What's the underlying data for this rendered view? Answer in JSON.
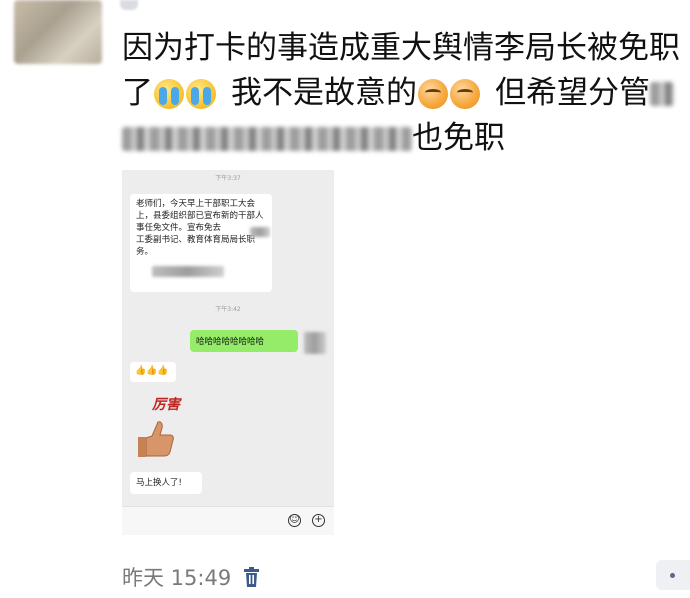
{
  "post": {
    "line1": "因为打卡的事造成重大舆情李局长被免职",
    "line2_a": "了",
    "line2_b": "我不是故意的",
    "line2_c": "但希望分管",
    "line3_end": "也免职"
  },
  "embedded_chat": {
    "time_1": "下午3:37",
    "message_1": "老师们，今天早上干部职工大会上，县委组织部已宣布新的干部人事任免文件。宣布免去",
    "message_1_b": "工委副书记、教育体育局局长职务。",
    "time_2": "下午3:42",
    "green_message": "哈哈哈哈哈哈哈哈",
    "thumbs": "👍👍👍",
    "sticker_text": "厉害",
    "last_message": "马上换人了!",
    "input_icons": [
      "emoji-icon",
      "plus-icon"
    ]
  },
  "footer": {
    "timestamp": "昨天 15:49",
    "delete_icon": "trash-icon",
    "more_icon": "more-dots-icon"
  },
  "colors": {
    "green_bubble": "#95ec69",
    "chat_bg": "#ededed",
    "meta_text": "#7a7a7a",
    "trash": "#3d5a8a"
  }
}
